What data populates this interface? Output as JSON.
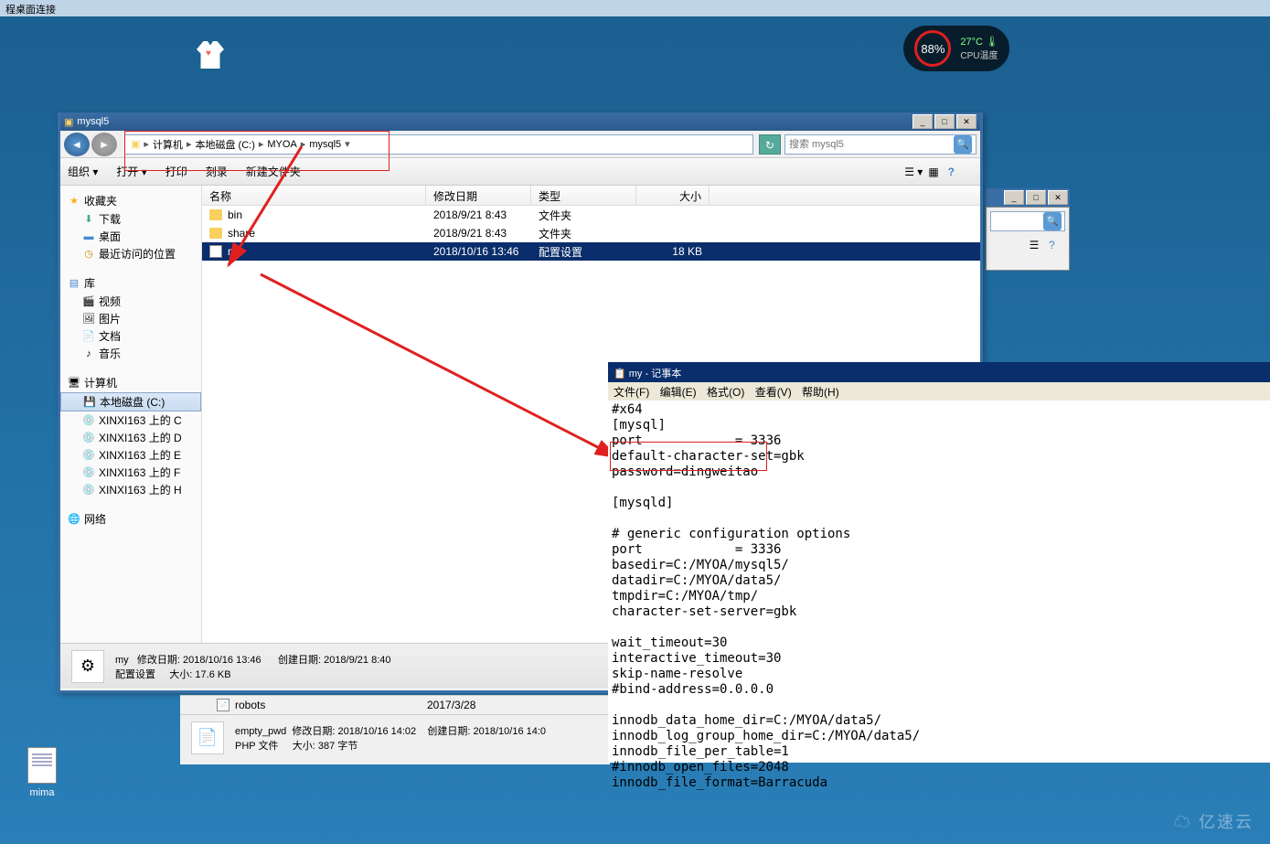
{
  "remote_desktop_title": "程桌面连接",
  "gauge": {
    "percent": "88%",
    "temp": "27°C",
    "temp_label": "CPU温度"
  },
  "explorer": {
    "title": "mysql5",
    "breadcrumb": [
      "计算机",
      "本地磁盘 (C:)",
      "MYOA",
      "mysql5"
    ],
    "search_placeholder": "搜索 mysql5",
    "toolbar": {
      "organize": "组织 ▾",
      "open": "打开 ▾",
      "print": "打印",
      "burn": "刻录",
      "new_folder": "新建文件夹"
    },
    "columns": {
      "name": "名称",
      "date": "修改日期",
      "type": "类型",
      "size": "大小"
    },
    "files": [
      {
        "name": "bin",
        "date": "2018/9/21 8:43",
        "type": "文件夹",
        "size": "",
        "kind": "folder"
      },
      {
        "name": "share",
        "date": "2018/9/21 8:43",
        "type": "文件夹",
        "size": "",
        "kind": "folder"
      },
      {
        "name": "my",
        "date": "2018/10/16 13:46",
        "type": "配置设置",
        "size": "18 KB",
        "kind": "cfg",
        "selected": true
      }
    ],
    "sidebar": {
      "favorites": {
        "label": "收藏夹",
        "items": [
          "下载",
          "桌面",
          "最近访问的位置"
        ]
      },
      "libraries": {
        "label": "库",
        "items": [
          "视频",
          "图片",
          "文档",
          "音乐"
        ]
      },
      "computer": {
        "label": "计算机",
        "items": [
          "本地磁盘 (C:)",
          "XINXI163 上的 C",
          "XINXI163 上的 D",
          "XINXI163 上的 E",
          "XINXI163 上的 F",
          "XINXI163 上的 H"
        ]
      },
      "network": {
        "label": "网络"
      }
    },
    "status": {
      "name": "my",
      "mod_label": "修改日期:",
      "mod": "2018/10/16 13:46",
      "create_label": "创建日期:",
      "create": "2018/9/21 8:40",
      "type": "配置设置",
      "size_label": "大小:",
      "size": "17.6 KB"
    }
  },
  "lower": {
    "robots": {
      "name": "robots",
      "date": "2017/3/28"
    },
    "empty_pwd": {
      "name": "empty_pwd",
      "mod_label": "修改日期:",
      "mod": "2018/10/16 14:02",
      "create_label": "创建日期:",
      "create": "2018/10/16 14:0",
      "type": "PHP 文件",
      "size_label": "大小:",
      "size": "387 字节"
    }
  },
  "notepad": {
    "title": "my - 记事本",
    "menu": {
      "file": "文件(F)",
      "edit": "编辑(E)",
      "format": "格式(O)",
      "view": "查看(V)",
      "help": "帮助(H)"
    },
    "content": "#x64\n[mysql]\nport            = 3336\ndefault-character-set=gbk\npassword=dingweitao\n\n[mysqld]\n\n# generic configuration options\nport            = 3336\nbasedir=C:/MYOA/mysql5/\ndatadir=C:/MYOA/data5/\ntmpdir=C:/MYOA/tmp/\ncharacter-set-server=gbk\n\nwait_timeout=30\ninteractive_timeout=30\nskip-name-resolve\n#bind-address=0.0.0.0\n\ninnodb_data_home_dir=C:/MYOA/data5/\ninnodb_log_group_home_dir=C:/MYOA/data5/\ninnodb_file_per_table=1\n#innodb_open_files=2048\ninnodb_file_format=Barracuda"
  },
  "desktop_file": "mima",
  "watermark": "亿速云"
}
